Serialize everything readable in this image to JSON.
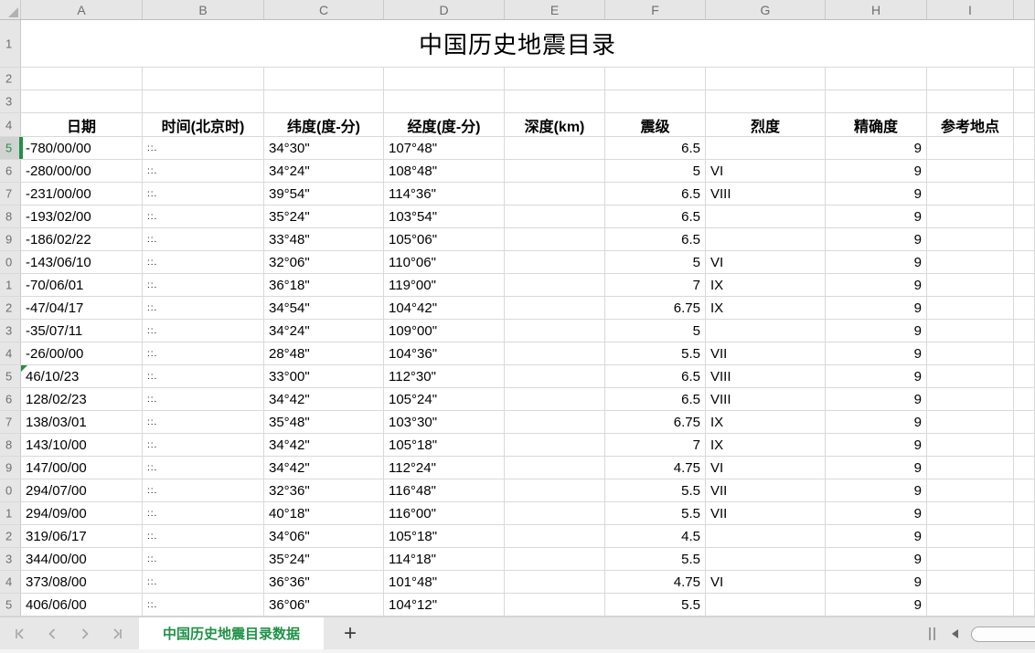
{
  "sheet": {
    "title": "中国历史地震目录",
    "column_letters": [
      "A",
      "B",
      "C",
      "D",
      "E",
      "F",
      "G",
      "H",
      "I"
    ],
    "row_labels": [
      "1",
      "2",
      "3",
      "4",
      "5",
      "6",
      "7",
      "8",
      "9",
      "0",
      "1",
      "2",
      "3",
      "4",
      "5",
      "6",
      "7",
      "8",
      "9",
      "0",
      "1",
      "2",
      "3",
      "4",
      "5"
    ],
    "header_row": {
      "row_index": 4,
      "cells": [
        "日期",
        "时间(北京时)",
        "纬度(度-分)",
        "经度(度-分)",
        "深度(km)",
        "震级",
        "烈度",
        "精确度",
        "参考地点"
      ]
    },
    "data_first_row": 5,
    "data_rows": [
      [
        "-780/00/00",
        "::.",
        "34°30\"",
        "107°48\"",
        "",
        "6.5",
        "",
        "9",
        ""
      ],
      [
        "-280/00/00",
        "::.",
        "34°24\"",
        "108°48\"",
        "",
        "5",
        "VI",
        "9",
        ""
      ],
      [
        "-231/00/00",
        "::.",
        "39°54\"",
        "114°36\"",
        "",
        "6.5",
        "VIII",
        "9",
        ""
      ],
      [
        "-193/02/00",
        "::.",
        "35°24\"",
        "103°54\"",
        "",
        "6.5",
        "",
        "9",
        ""
      ],
      [
        "-186/02/22",
        "::.",
        "33°48\"",
        "105°06\"",
        "",
        "6.5",
        "",
        "9",
        ""
      ],
      [
        "-143/06/10",
        "::.",
        "32°06\"",
        "110°06\"",
        "",
        "5",
        "VI",
        "9",
        ""
      ],
      [
        "-70/06/01",
        "::.",
        "36°18\"",
        "119°00\"",
        "",
        "7",
        "IX",
        "9",
        ""
      ],
      [
        "-47/04/17",
        "::.",
        "34°54\"",
        "104°42\"",
        "",
        "6.75",
        "IX",
        "9",
        ""
      ],
      [
        "-35/07/11",
        "::.",
        "34°24\"",
        "109°00\"",
        "",
        "5",
        "",
        "9",
        ""
      ],
      [
        "-26/00/00",
        "::.",
        "28°48\"",
        "104°36\"",
        "",
        "5.5",
        "VII",
        "9",
        ""
      ],
      [
        "46/10/23",
        "::.",
        "33°00\"",
        "112°30\"",
        "",
        "6.5",
        "VIII",
        "9",
        ""
      ],
      [
        "128/02/23",
        "::.",
        "34°42\"",
        "105°24\"",
        "",
        "6.5",
        "VIII",
        "9",
        ""
      ],
      [
        "138/03/01",
        "::.",
        "35°48\"",
        "103°30\"",
        "",
        "6.75",
        "IX",
        "9",
        ""
      ],
      [
        "143/10/00",
        "::.",
        "34°42\"",
        "105°18\"",
        "",
        "7",
        "IX",
        "9",
        ""
      ],
      [
        "147/00/00",
        "::.",
        "34°42\"",
        "112°24\"",
        "",
        "4.75",
        "VI",
        "9",
        ""
      ],
      [
        "294/07/00",
        "::.",
        "32°36\"",
        "116°48\"",
        "",
        "5.5",
        "VII",
        "9",
        ""
      ],
      [
        "294/09/00",
        "::.",
        "40°18\"",
        "116°00\"",
        "",
        "5.5",
        "VII",
        "9",
        ""
      ],
      [
        "319/06/17",
        "::.",
        "34°06\"",
        "105°18\"",
        "",
        "4.5",
        "",
        "9",
        ""
      ],
      [
        "344/00/00",
        "::.",
        "35°24\"",
        "114°18\"",
        "",
        "5.5",
        "",
        "9",
        ""
      ],
      [
        "373/08/00",
        "::.",
        "36°36\"",
        "101°48\"",
        "",
        "4.75",
        "VI",
        "9",
        ""
      ],
      [
        "406/06/00",
        "::.",
        "36°06\"",
        "104°12\"",
        "",
        "5.5",
        "",
        "9",
        ""
      ]
    ],
    "selection": {
      "active_cell": "A5",
      "active_row_label": "5"
    },
    "flagged_cell": {
      "cell": "A15"
    }
  },
  "tabbar": {
    "active_tab": "中国历史地震目录数据",
    "add_sheet_label": "+"
  },
  "colors": {
    "accent_green": "#1f9246",
    "header_bg": "#e6e6e6",
    "selected_header_bg": "#d2d2d2",
    "grid_line": "#d9d9d9",
    "tabbar_bg": "#e7e7e7"
  }
}
